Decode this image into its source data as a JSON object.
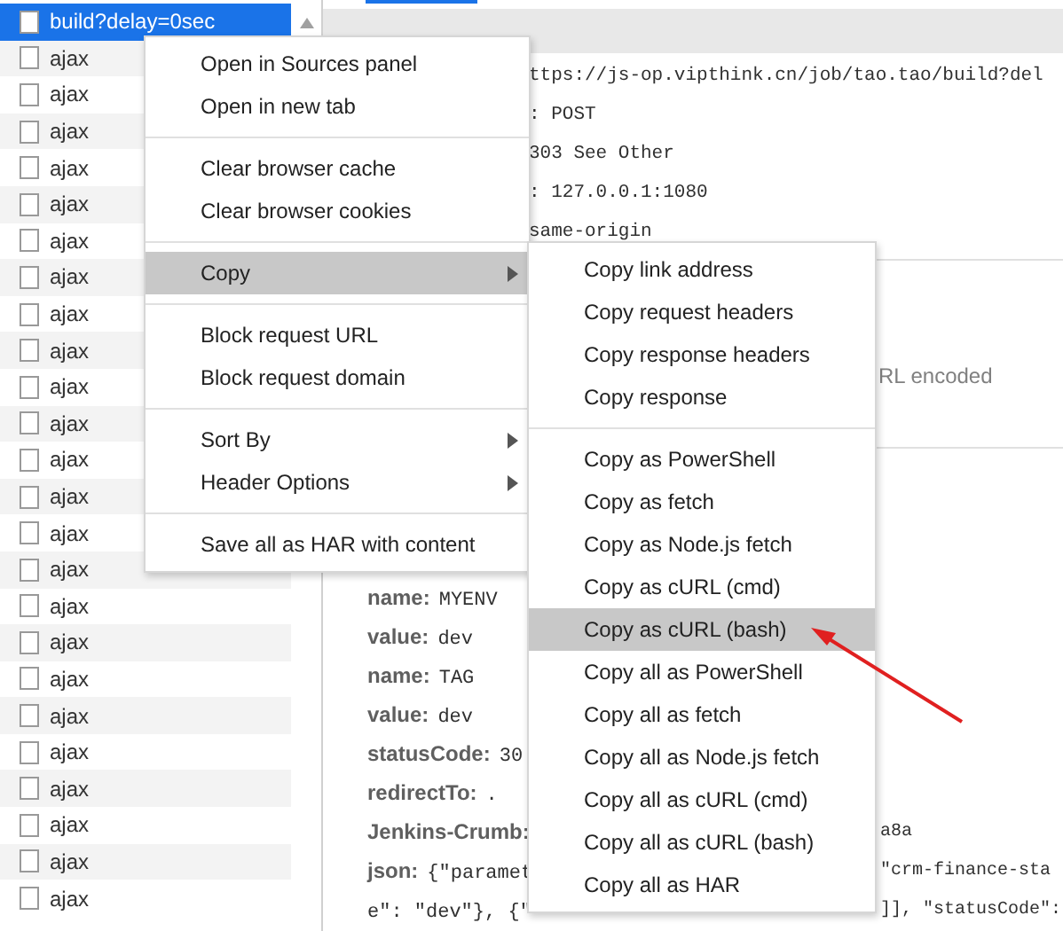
{
  "requests": [
    {
      "name": "build?delay=0sec",
      "selected": true
    },
    {
      "name": "ajax",
      "selected": false
    },
    {
      "name": "ajax",
      "selected": false
    },
    {
      "name": "ajax",
      "selected": false
    },
    {
      "name": "ajax",
      "selected": false
    },
    {
      "name": "ajax",
      "selected": false
    },
    {
      "name": "ajax",
      "selected": false
    },
    {
      "name": "ajax",
      "selected": false
    },
    {
      "name": "ajax",
      "selected": false
    },
    {
      "name": "ajax",
      "selected": false
    },
    {
      "name": "ajax",
      "selected": false
    },
    {
      "name": "ajax",
      "selected": false
    },
    {
      "name": "ajax",
      "selected": false
    },
    {
      "name": "ajax",
      "selected": false
    },
    {
      "name": "ajax",
      "selected": false
    },
    {
      "name": "ajax",
      "selected": false
    },
    {
      "name": "ajax",
      "selected": false
    },
    {
      "name": "ajax",
      "selected": false
    },
    {
      "name": "ajax",
      "selected": false
    },
    {
      "name": "ajax",
      "selected": false
    },
    {
      "name": "ajax",
      "selected": false
    },
    {
      "name": "ajax",
      "selected": false
    },
    {
      "name": "ajax",
      "selected": false
    },
    {
      "name": "ajax",
      "selected": false
    },
    {
      "name": "ajax",
      "selected": false
    }
  ],
  "details": {
    "top_lines": [
      "ttps://js-op.vipthink.cn/job/tao.tao/build?del",
      ": POST",
      "303 See Other",
      ": 127.0.0.1:1080",
      "same-origin"
    ],
    "note": "RL encoded",
    "fields": [
      {
        "key": "name:",
        "value": "MYENV"
      },
      {
        "key": "value:",
        "value": "dev"
      },
      {
        "key": "name:",
        "value": "TAG"
      },
      {
        "key": "value:",
        "value": "dev"
      },
      {
        "key": "statusCode:",
        "value": "30"
      },
      {
        "key": "redirectTo:",
        "value": "."
      },
      {
        "key": "Jenkins-Crumb:",
        "tail": "a8a"
      },
      {
        "key": "json:",
        "value": "{\"paramet",
        "tail": "\"crm-finance-sta"
      },
      {
        "value": "e\": \"dev\"}, {\"",
        "tail": "]], \"statusCode\":"
      }
    ]
  },
  "context_menu": {
    "groups": [
      [
        {
          "label": "Open in Sources panel",
          "submenu": false,
          "selected": false
        },
        {
          "label": "Open in new tab",
          "submenu": false,
          "selected": false
        }
      ],
      [
        {
          "label": "Clear browser cache",
          "submenu": false,
          "selected": false
        },
        {
          "label": "Clear browser cookies",
          "submenu": false,
          "selected": false
        }
      ],
      [
        {
          "label": "Copy",
          "submenu": true,
          "selected": true
        }
      ],
      [
        {
          "label": "Block request URL",
          "submenu": false,
          "selected": false
        },
        {
          "label": "Block request domain",
          "submenu": false,
          "selected": false
        }
      ],
      [
        {
          "label": "Sort By",
          "submenu": true,
          "selected": false
        },
        {
          "label": "Header Options",
          "submenu": true,
          "selected": false
        }
      ],
      [
        {
          "label": "Save all as HAR with content",
          "submenu": false,
          "selected": false
        }
      ]
    ]
  },
  "copy_submenu": {
    "groups": [
      [
        {
          "label": "Copy link address",
          "selected": false
        },
        {
          "label": "Copy request headers",
          "selected": false
        },
        {
          "label": "Copy response headers",
          "selected": false
        },
        {
          "label": "Copy response",
          "selected": false
        }
      ],
      [
        {
          "label": "Copy as PowerShell",
          "selected": false
        },
        {
          "label": "Copy as fetch",
          "selected": false
        },
        {
          "label": "Copy as Node.js fetch",
          "selected": false
        },
        {
          "label": "Copy as cURL (cmd)",
          "selected": false
        },
        {
          "label": "Copy as cURL (bash)",
          "selected": true
        },
        {
          "label": "Copy all as PowerShell",
          "selected": false
        },
        {
          "label": "Copy all as fetch",
          "selected": false
        },
        {
          "label": "Copy all as Node.js fetch",
          "selected": false
        },
        {
          "label": "Copy all as cURL (cmd)",
          "selected": false
        },
        {
          "label": "Copy all as cURL (bash)",
          "selected": false
        },
        {
          "label": "Copy all as HAR",
          "selected": false
        }
      ]
    ]
  }
}
